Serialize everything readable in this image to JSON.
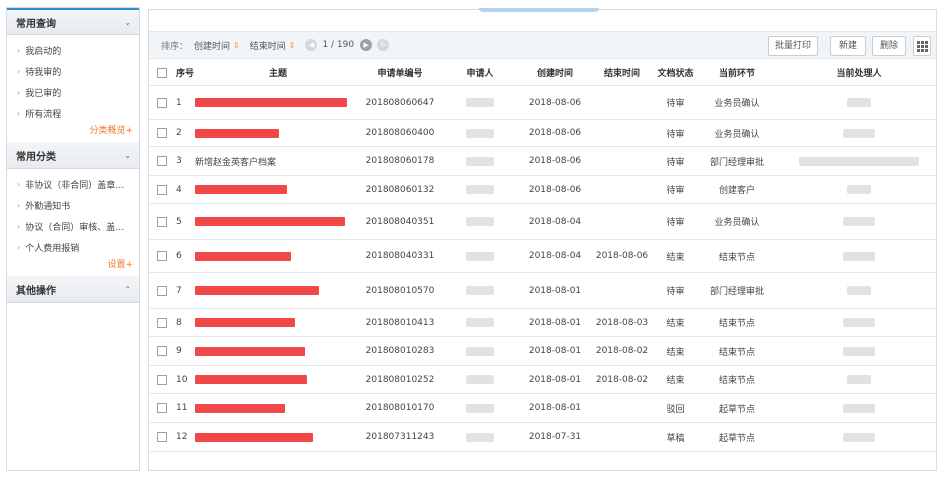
{
  "sidebar": {
    "sections": [
      {
        "title": "常用查询",
        "expanded": true,
        "items": [
          "我启动的",
          "待我审的",
          "我已审的",
          "所有流程"
        ],
        "link": "分类概览+"
      },
      {
        "title": "常用分类",
        "expanded": true,
        "items": [
          "非协议（非合同）盖章…",
          "外勤通知书",
          "协议（合同）审核、盖…",
          "个人费用报销"
        ],
        "link": "设置+"
      },
      {
        "title": "其他操作",
        "expanded": false,
        "items": [],
        "link": ""
      }
    ]
  },
  "toolbar": {
    "sort_label": "排序：",
    "sort_keys": [
      "创建时间",
      "结束时间"
    ],
    "page": "1 / 190",
    "buttons": {
      "batch_print": "批量打印",
      "new": "新建",
      "delete": "删除"
    },
    "grid_icon": "grid-icon"
  },
  "table": {
    "columns": [
      "序号",
      "主题",
      "申请单编号",
      "申请人",
      "创建时间",
      "结束时间",
      "文档状态",
      "当前环节",
      "当前处理人"
    ],
    "rows": [
      {
        "no": "1",
        "title": "",
        "redacted_width": 152,
        "req_no": "201808060647",
        "created": "2018-08-06",
        "ended": "",
        "status": "待审",
        "node": "业务员确认",
        "handler_redacted": true
      },
      {
        "no": "2",
        "title": "",
        "redacted_width": 84,
        "req_no": "201808060400",
        "created": "2018-08-06",
        "ended": "",
        "status": "待审",
        "node": "业务员确认",
        "handler_redacted": true
      },
      {
        "no": "3",
        "title": "新增赵金英客户档案",
        "redacted_width": 0,
        "req_no": "201808060178",
        "created": "2018-08-06",
        "ended": "",
        "status": "待审",
        "node": "部门经理审批",
        "handler_redacted": true
      },
      {
        "no": "4",
        "title": "",
        "redacted_width": 92,
        "req_no": "201808060132",
        "created": "2018-08-06",
        "ended": "",
        "status": "待审",
        "node": "创建客户",
        "handler_redacted": true
      },
      {
        "no": "5",
        "title": "",
        "redacted_width": 150,
        "req_no": "201808040351",
        "created": "2018-08-04",
        "ended": "",
        "status": "待审",
        "node": "业务员确认",
        "handler_redacted": true
      },
      {
        "no": "6",
        "title": "",
        "redacted_width": 96,
        "req_no": "201808040331",
        "created": "2018-08-04",
        "ended": "2018-08-06",
        "status": "结束",
        "node": "结束节点",
        "handler_redacted": true
      },
      {
        "no": "7",
        "title": "",
        "redacted_width": 124,
        "req_no": "201808010570",
        "created": "2018-08-01",
        "ended": "",
        "status": "待审",
        "node": "部门经理审批",
        "handler_redacted": true
      },
      {
        "no": "8",
        "title": "",
        "redacted_width": 100,
        "req_no": "201808010413",
        "created": "2018-08-01",
        "ended": "2018-08-03",
        "status": "结束",
        "node": "结束节点",
        "handler_redacted": true
      },
      {
        "no": "9",
        "title": "",
        "redacted_width": 110,
        "req_no": "201808010283",
        "created": "2018-08-01",
        "ended": "2018-08-02",
        "status": "结束",
        "node": "结束节点",
        "handler_redacted": true
      },
      {
        "no": "10",
        "title": "",
        "redacted_width": 112,
        "req_no": "201808010252",
        "created": "2018-08-01",
        "ended": "2018-08-02",
        "status": "结束",
        "node": "结束节点",
        "handler_redacted": true
      },
      {
        "no": "11",
        "title": "",
        "redacted_width": 90,
        "req_no": "201808010170",
        "created": "2018-08-01",
        "ended": "",
        "status": "驳回",
        "node": "起草节点",
        "handler_redacted": true
      },
      {
        "no": "12",
        "title": "",
        "redacted_width": 118,
        "req_no": "201807311243",
        "created": "2018-07-31",
        "ended": "",
        "status": "草稿",
        "node": "起草节点",
        "handler_redacted": true
      }
    ]
  },
  "colors": {
    "accent": "#2f8fd5",
    "redaction": "#f04848",
    "link_orange": "#f07a2a",
    "sort_arrow": "#f0a020"
  }
}
